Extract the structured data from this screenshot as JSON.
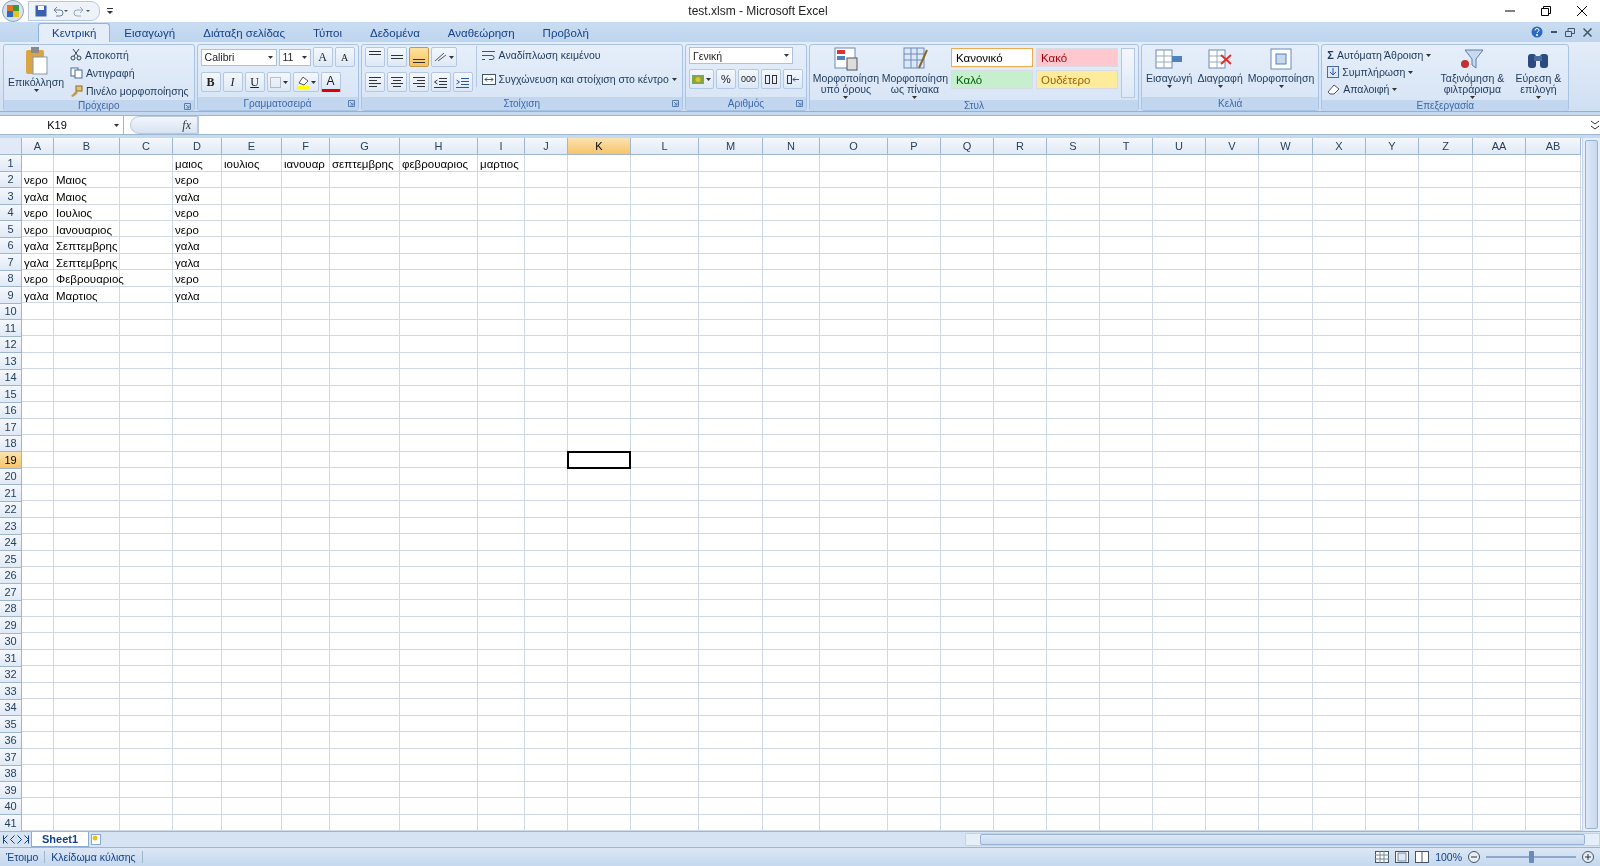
{
  "window": {
    "title": "test.xlsm - Microsoft Excel"
  },
  "tabs": [
    {
      "label": "Κεντρική",
      "selected": true
    },
    {
      "label": "Εισαγωγή",
      "selected": false
    },
    {
      "label": "Διάταξη σελίδας",
      "selected": false
    },
    {
      "label": "Τύποι",
      "selected": false
    },
    {
      "label": "Δεδομένα",
      "selected": false
    },
    {
      "label": "Αναθεώρηση",
      "selected": false
    },
    {
      "label": "Προβολή",
      "selected": false
    }
  ],
  "ribbon": {
    "clipboard": {
      "title": "Πρόχειρο",
      "paste": "Επικόλληση",
      "actions": [
        {
          "kind": "cut",
          "label": "Αποκοπή"
        },
        {
          "kind": "copy",
          "label": "Αντιγραφή"
        },
        {
          "kind": "brush",
          "label": "Πινέλο μορφοποίησης"
        }
      ]
    },
    "font": {
      "title": "Γραμματοσειρά",
      "name": "Calibri",
      "size": "11",
      "grow": "A",
      "shrink": "A",
      "styles": [
        "B",
        "I",
        "U"
      ],
      "color_letter": "A"
    },
    "alignment": {
      "title": "Στοίχιση",
      "vertical": [
        {
          "kind": "top",
          "selected": false
        },
        {
          "kind": "middle",
          "selected": false
        },
        {
          "kind": "bottom",
          "selected": true
        }
      ],
      "wrap": "Αναδίπλωση κειμένου",
      "merge": "Συγχώνευση και στοίχιση στο κέντρο"
    },
    "number": {
      "title": "Αριθμός",
      "format": "Γενική",
      "percent": "%",
      "thousands": "000"
    },
    "styles": {
      "title": "Στυλ",
      "conditional": "Μορφοποίηση υπό όρους",
      "as_table": "Μορφοποίηση ως πίνακα",
      "cell_styles": [
        {
          "kind": "normal",
          "label": "Κανονικό"
        },
        {
          "kind": "bad",
          "label": "Κακό"
        },
        {
          "kind": "good",
          "label": "Καλό"
        },
        {
          "kind": "neutral",
          "label": "Ουδέτερο"
        }
      ]
    },
    "cells": {
      "title": "Κελιά",
      "actions": [
        {
          "kind": "insert",
          "label": "Εισαγωγή"
        },
        {
          "kind": "delete",
          "label": "Διαγραφή"
        },
        {
          "kind": "format",
          "label": "Μορφοποίηση"
        }
      ]
    },
    "editing": {
      "title": "Επεξεργασία",
      "sum_symbol": "Σ",
      "actions": [
        {
          "kind": "sum",
          "label": "Αυτόματη Άθροιση"
        },
        {
          "kind": "fill",
          "label": "Συμπλήρωση"
        },
        {
          "kind": "clear",
          "label": "Απαλοιφή"
        }
      ],
      "sort": "Ταξινόμηση & φιλτράρισμα",
      "find": "Εύρεση & επιλογή"
    }
  },
  "formula_bar": {
    "name_box": "K19",
    "function_label": "fx"
  },
  "sheet": {
    "columns": [
      {
        "label": "A",
        "selected": false
      },
      {
        "label": "B",
        "selected": false
      },
      {
        "label": "C",
        "selected": false
      },
      {
        "label": "D",
        "selected": false
      },
      {
        "label": "E",
        "selected": false
      },
      {
        "label": "F",
        "selected": false
      },
      {
        "label": "G",
        "selected": false
      },
      {
        "label": "H",
        "selected": false
      },
      {
        "label": "I",
        "selected": false
      },
      {
        "label": "J",
        "selected": false
      },
      {
        "label": "K",
        "selected": true
      },
      {
        "label": "L",
        "selected": false
      },
      {
        "label": "M",
        "selected": false
      },
      {
        "label": "N",
        "selected": false
      },
      {
        "label": "O",
        "selected": false
      },
      {
        "label": "P",
        "selected": false
      },
      {
        "label": "Q",
        "selected": false
      },
      {
        "label": "R",
        "selected": false
      },
      {
        "label": "S",
        "selected": false
      },
      {
        "label": "T",
        "selected": false
      },
      {
        "label": "U",
        "selected": false
      },
      {
        "label": "V",
        "selected": false
      },
      {
        "label": "W",
        "selected": false
      },
      {
        "label": "X",
        "selected": false
      },
      {
        "label": "Y",
        "selected": false
      },
      {
        "label": "Z",
        "selected": false
      },
      {
        "label": "AA",
        "selected": false
      },
      {
        "label": "AB",
        "selected": false
      }
    ],
    "rows": [
      {
        "label": "1",
        "selected": false,
        "cells": [
          null,
          null,
          null,
          "μαιος",
          "ιουλιος",
          "ιανουαρ",
          "σεπτεμβρης",
          "φεβρουαριος",
          "μαρτιος"
        ]
      },
      {
        "label": "2",
        "selected": false,
        "cells": [
          "νερο",
          "Μαιος",
          null,
          "νερο"
        ]
      },
      {
        "label": "3",
        "selected": false,
        "cells": [
          "γαλα",
          "Μαιος",
          null,
          "γαλα"
        ]
      },
      {
        "label": "4",
        "selected": false,
        "cells": [
          "νερο",
          "Ιουλιος",
          null,
          "νερο"
        ]
      },
      {
        "label": "5",
        "selected": false,
        "cells": [
          "νερο",
          "Ιανουαριος",
          null,
          "νερο"
        ]
      },
      {
        "label": "6",
        "selected": false,
        "cells": [
          "γαλα",
          "Σεπτεμβρης",
          null,
          "γαλα"
        ]
      },
      {
        "label": "7",
        "selected": false,
        "cells": [
          "γαλα",
          "Σεπτεμβρης",
          null,
          "γαλα"
        ]
      },
      {
        "label": "8",
        "selected": false,
        "cells": [
          "νερο",
          "Φεβρουαριος",
          null,
          "νερο"
        ]
      },
      {
        "label": "9",
        "selected": false,
        "cells": [
          "γαλα",
          "Μαρτιος",
          null,
          "γαλα"
        ]
      },
      {
        "label": "10",
        "selected": false
      },
      {
        "label": "11",
        "selected": false
      },
      {
        "label": "12",
        "selected": false
      },
      {
        "label": "13",
        "selected": false
      },
      {
        "label": "14",
        "selected": false
      },
      {
        "label": "15",
        "selected": false
      },
      {
        "label": "16",
        "selected": false
      },
      {
        "label": "17",
        "selected": false
      },
      {
        "label": "18",
        "selected": false
      },
      {
        "label": "19",
        "selected": true
      },
      {
        "label": "20",
        "selected": false
      },
      {
        "label": "21",
        "selected": false
      },
      {
        "label": "22",
        "selected": false
      },
      {
        "label": "23",
        "selected": false
      },
      {
        "label": "24",
        "selected": false
      },
      {
        "label": "25",
        "selected": false
      },
      {
        "label": "26",
        "selected": false
      },
      {
        "label": "27",
        "selected": false
      },
      {
        "label": "28",
        "selected": false
      },
      {
        "label": "29",
        "selected": false
      },
      {
        "label": "30",
        "selected": false
      },
      {
        "label": "31",
        "selected": false
      },
      {
        "label": "32",
        "selected": false
      },
      {
        "label": "33",
        "selected": false
      },
      {
        "label": "34",
        "selected": false
      },
      {
        "label": "35",
        "selected": false
      },
      {
        "label": "36",
        "selected": false
      },
      {
        "label": "37",
        "selected": false
      },
      {
        "label": "38",
        "selected": false
      },
      {
        "label": "39",
        "selected": false
      },
      {
        "label": "40",
        "selected": false
      },
      {
        "label": "41",
        "selected": false
      }
    ]
  },
  "sheet_tabs": [
    {
      "label": "Sheet1",
      "selected": true
    }
  ],
  "status_bar": {
    "items": [
      "Έτοιμο",
      "Κλείδωμα κύλισης"
    ],
    "zoom": {
      "label": "100%",
      "level": 0.5
    }
  }
}
